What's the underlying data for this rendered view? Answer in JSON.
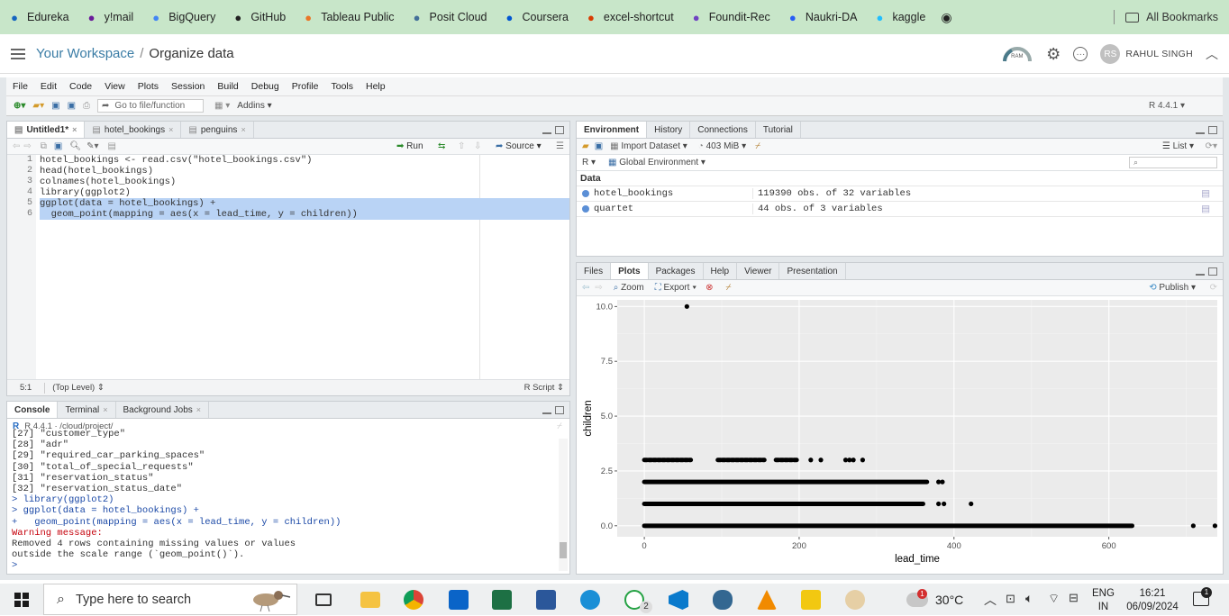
{
  "bookmarks": [
    {
      "label": "Edureka",
      "icon": "edureka-icon",
      "color": "#1565c0"
    },
    {
      "label": "y!mail",
      "icon": "mail-icon",
      "color": "#6a1b9a"
    },
    {
      "label": "BigQuery",
      "icon": "bigquery-icon",
      "color": "#4285f4"
    },
    {
      "label": "GitHub",
      "icon": "github-icon",
      "color": "#222222"
    },
    {
      "label": "Tableau Public",
      "icon": "tableau-icon",
      "color": "#e97627"
    },
    {
      "label": "Posit Cloud",
      "icon": "posit-icon",
      "color": "#447099"
    },
    {
      "label": "Coursera",
      "icon": "coursera-icon",
      "color": "#0056d2"
    },
    {
      "label": "excel-shortcut",
      "icon": "excel-shortcut-icon",
      "color": "#d83b01"
    },
    {
      "label": "Foundit-Rec",
      "icon": "foundit-icon",
      "color": "#6f42c1"
    },
    {
      "label": "Naukri-DA",
      "icon": "naukri-icon",
      "color": "#275df5"
    },
    {
      "label": "kaggle",
      "icon": "kaggle-icon",
      "color": "#20beff"
    }
  ],
  "bookmarks_all": "All Bookmarks",
  "header": {
    "workspace": "Your Workspace",
    "separator": "/",
    "project": "Organize data",
    "ram": "RAM",
    "user_initials": "RS",
    "user_name": "RAHUL SINGH"
  },
  "menu": [
    "File",
    "Edit",
    "Code",
    "View",
    "Plots",
    "Session",
    "Build",
    "Debug",
    "Profile",
    "Tools",
    "Help"
  ],
  "toolbar": {
    "goto": "Go to file/function",
    "addins": "Addins",
    "r_version": "R 4.4.1"
  },
  "editor": {
    "tabs": [
      "Untitled1*",
      "hotel_bookings",
      "penguins"
    ],
    "run": "Run",
    "source": "Source",
    "lines": [
      "hotel_bookings <- read.csv(\"hotel_bookings.csv\")",
      "head(hotel_bookings)",
      "colnames(hotel_bookings)",
      "library(ggplot2)",
      "ggplot(data = hotel_bookings) +",
      "  geom_point(mapping = aes(x = lead_time, y = children))"
    ],
    "line_numbers": [
      "1",
      "2",
      "3",
      "4",
      "5",
      "6"
    ],
    "position": "5:1",
    "scope": "(Top Level)",
    "filetype": "R Script"
  },
  "console": {
    "tabs": [
      "Console",
      "Terminal",
      "Background Jobs"
    ],
    "path": "R 4.4.1 · /cloud/project/",
    "lines": [
      {
        "t": "[27] \"customer_type\"",
        "c": ""
      },
      {
        "t": "[28] \"adr\"",
        "c": ""
      },
      {
        "t": "[29] \"required_car_parking_spaces\"",
        "c": ""
      },
      {
        "t": "[30] \"total_of_special_requests\"",
        "c": ""
      },
      {
        "t": "[31] \"reservation_status\"",
        "c": ""
      },
      {
        "t": "[32] \"reservation_status_date\"",
        "c": ""
      },
      {
        "t": "> library(ggplot2)",
        "c": "blue"
      },
      {
        "t": "> ggplot(data = hotel_bookings) +",
        "c": "blue"
      },
      {
        "t": "+   geom_point(mapping = aes(x = lead_time, y = children))",
        "c": "blue"
      },
      {
        "t": "Warning message:",
        "c": "red"
      },
      {
        "t": "Removed 4 rows containing missing values or values",
        "c": ""
      },
      {
        "t": "outside the scale range (`geom_point()`).",
        "c": ""
      },
      {
        "t": "> ",
        "c": "blue"
      }
    ]
  },
  "environment": {
    "tabs": [
      "Environment",
      "History",
      "Connections",
      "Tutorial"
    ],
    "import": "Import Dataset",
    "memory": "403 MiB",
    "view": "List",
    "lang": "R",
    "scope": "Global Environment",
    "section": "Data",
    "rows": [
      {
        "name": "hotel_bookings",
        "value": "119390 obs. of 32 variables"
      },
      {
        "name": "quartet",
        "value": "44 obs. of 3 variables"
      }
    ]
  },
  "files": {
    "tabs": [
      "Files",
      "Plots",
      "Packages",
      "Help",
      "Viewer",
      "Presentation"
    ],
    "zoom": "Zoom",
    "export": "Export",
    "publish": "Publish"
  },
  "chart_data": {
    "type": "scatter",
    "xlabel": "lead_time",
    "ylabel": "children",
    "xlim": [
      -35,
      740
    ],
    "ylim": [
      -0.5,
      10.3
    ],
    "xticks": [
      0,
      200,
      400,
      600
    ],
    "yticks": [
      0.0,
      2.5,
      5.0,
      7.5,
      10.0
    ],
    "ytick_labels": [
      "0.0",
      "2.5",
      "5.0",
      "7.5",
      "10.0"
    ],
    "grid": true,
    "segments": [
      {
        "y": 0,
        "x": [
          0,
          630
        ]
      },
      {
        "y": 1,
        "x": [
          0,
          360
        ]
      },
      {
        "y": 2,
        "x": [
          0,
          365
        ]
      },
      {
        "y": 3,
        "x": [
          0,
          60
        ]
      },
      {
        "y": 3,
        "x": [
          95,
          155
        ]
      },
      {
        "y": 3,
        "x": [
          170,
          198
        ]
      }
    ],
    "points": [
      {
        "x": 55,
        "y": 10
      },
      {
        "x": 380,
        "y": 2
      },
      {
        "x": 385,
        "y": 2
      },
      {
        "x": 380,
        "y": 1
      },
      {
        "x": 387,
        "y": 1
      },
      {
        "x": 422,
        "y": 1
      },
      {
        "x": 215,
        "y": 3
      },
      {
        "x": 228,
        "y": 3
      },
      {
        "x": 260,
        "y": 3
      },
      {
        "x": 265,
        "y": 3
      },
      {
        "x": 270,
        "y": 3
      },
      {
        "x": 282,
        "y": 3
      },
      {
        "x": 709,
        "y": 0
      },
      {
        "x": 737,
        "y": 0
      }
    ]
  },
  "taskbar": {
    "search": "Type here to search",
    "temp": "30°C",
    "lang1": "ENG",
    "lang2": "IN",
    "time": "16:21",
    "date": "06/09/2024",
    "notif": "1",
    "badge": "2"
  }
}
